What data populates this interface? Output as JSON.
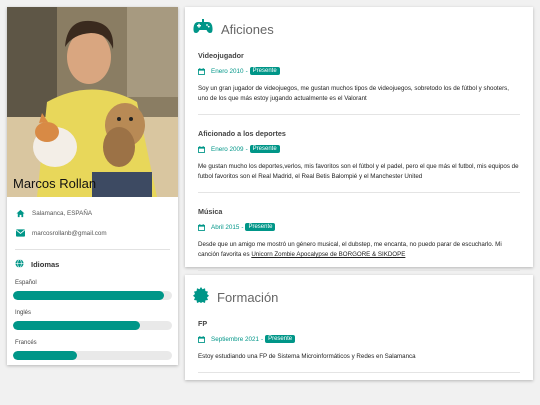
{
  "profile": {
    "name": "Marcos Rollan",
    "location": "Salamanca, ESPAÑA",
    "email": "marcosrollanb@gmail.com"
  },
  "languages": {
    "title": "Idiomas",
    "items": [
      {
        "name": "Español",
        "level": 0.95
      },
      {
        "name": "Inglés",
        "level": 0.8
      },
      {
        "name": "Francés",
        "level": 0.4
      }
    ]
  },
  "hobbies": {
    "title": "Aficiones",
    "entries": [
      {
        "title": "Videojugador",
        "date": "Enero 2010",
        "badge": "Presente",
        "desc": "Soy un gran jugador de videojuegos, me gustan muchos tipos de videojuegos, sobretodo los de fútbol y shooters, uno de los que más estoy jugando actualmente es el Valorant"
      },
      {
        "title": "Aficionado a los deportes",
        "date": "Enero 2009",
        "badge": "Presente",
        "desc": "Me gustan mucho los deportes,verlos, mis favoritos son el fútbol y el padel, pero el que más el futbol, mis equipos de futbol favoritos son el Real Madrid, el Real Betis Balompié y el Manchester United"
      },
      {
        "title": "Música",
        "date": "Abril 2015",
        "badge": "Presente",
        "desc_before": "Desde que un amigo me mostró un género musical, el dubstep, me encanta, no puedo parar de escucharlo. Mi canción favorita es ",
        "song_link": "Unicorn Zombie Apocalypse de BORGORE & SIKDOPE"
      }
    ]
  },
  "education": {
    "title": "Formación",
    "entries": [
      {
        "title": "FP",
        "date": "Septiembre 2021",
        "badge": "Presente",
        "desc": "Estoy estudiando una FP de Sistema Microinformáticos y Redes en Salamanca"
      }
    ]
  },
  "colors": {
    "accent": "#009688"
  },
  "icons": [
    "home-icon",
    "envelope-icon",
    "globe-icon",
    "gamepad-icon",
    "calendar-icon",
    "certificate-icon"
  ]
}
